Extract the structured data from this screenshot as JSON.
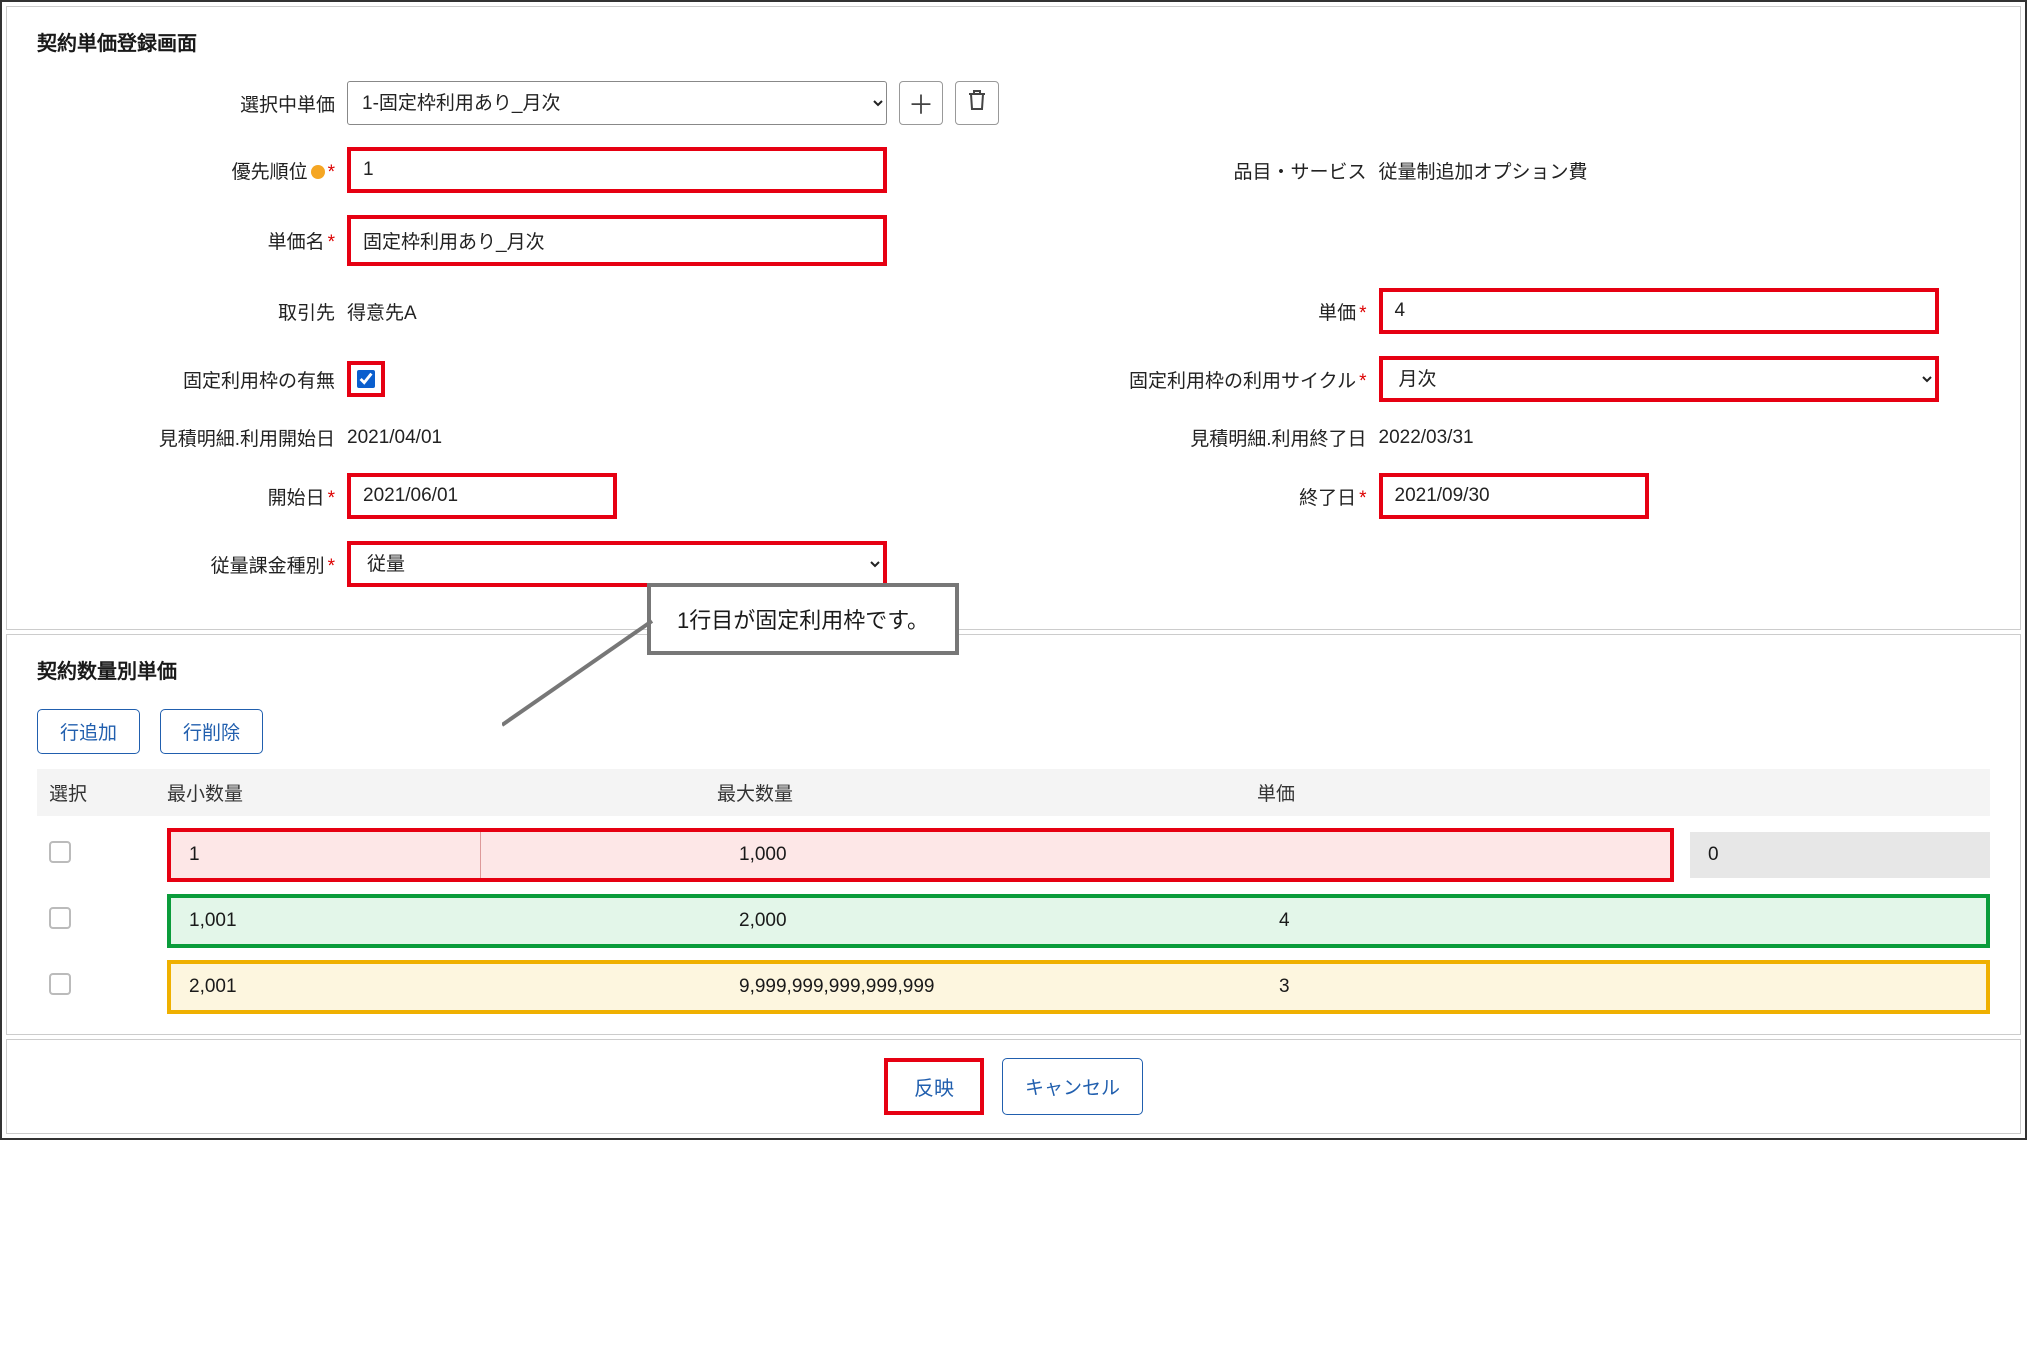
{
  "sectionTop": {
    "title": "契約単価登録画面",
    "labels": {
      "selected": "選択中単価",
      "priority": "優先順位",
      "unitName": "単価名",
      "partner": "取引先",
      "fixedFlag": "固定利用枠の有無",
      "estStart": "見積明細.利用開始日",
      "start": "開始日",
      "chargeType": "従量課金種別",
      "item": "品目・サービス",
      "unitPrice": "単価",
      "cycle": "固定利用枠の利用サイクル",
      "estEnd": "見積明細.利用終了日",
      "end": "終了日"
    },
    "values": {
      "selected": "1-固定枠利用あり_月次",
      "priority": "1",
      "unitName": "固定枠利用あり_月次",
      "partner": "得意先A",
      "fixedFlag": true,
      "estStart": "2021/04/01",
      "start": "2021/06/01",
      "chargeType": "従量",
      "item": "従量制追加オプション費",
      "unitPrice": "4",
      "cycle": "月次",
      "estEnd": "2022/03/31",
      "end": "2021/09/30"
    }
  },
  "sectionBottom": {
    "title": "契約数量別単価",
    "addRow": "行追加",
    "delRow": "行削除",
    "callout": "1行目が固定利用枠です。",
    "headers": {
      "select": "選択",
      "min": "最小数量",
      "max": "最大数量",
      "price": "単価"
    },
    "rows": [
      {
        "min": "1",
        "max": "1,000",
        "price": "0",
        "style": "red",
        "priceGray": true
      },
      {
        "min": "1,001",
        "max": "2,000",
        "price": "4",
        "style": "green",
        "priceGray": false
      },
      {
        "min": "2,001",
        "max": "9,999,999,999,999,999",
        "price": "3",
        "style": "yellow",
        "priceGray": false
      }
    ]
  },
  "actions": {
    "apply": "反映",
    "cancel": "キャンセル"
  }
}
